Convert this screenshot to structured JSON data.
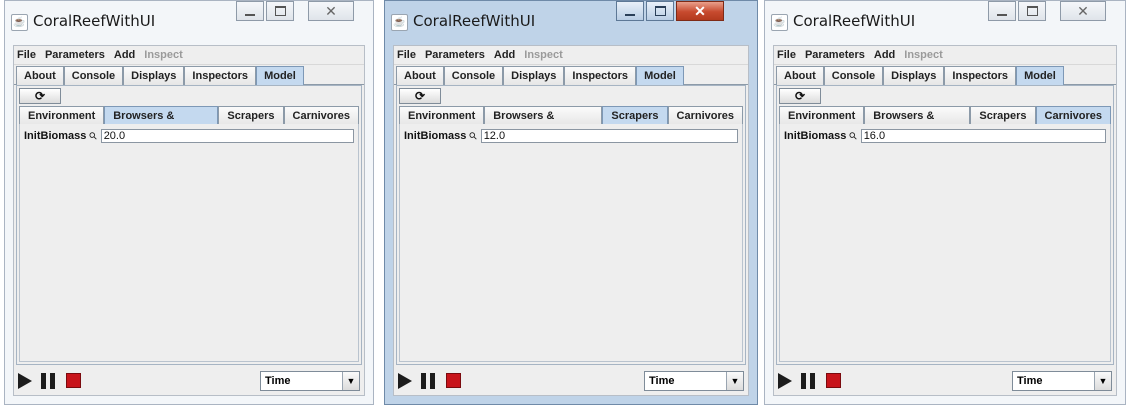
{
  "windows": [
    {
      "title": "CoralReefWithUI",
      "active": false,
      "menu": [
        "File",
        "Parameters",
        "Add",
        "Inspect"
      ],
      "main_tabs": [
        "About",
        "Console",
        "Displays",
        "Inspectors",
        "Model"
      ],
      "main_selected": "Model",
      "reload_icon": "refresh-icon",
      "sub_tabs": [
        "Environment",
        "Browsers & Grazers",
        "Scrapers",
        "Carnivores"
      ],
      "sub_selected": "Browsers & Grazers",
      "field_label": "InitBiomass",
      "field_value": "20.0",
      "time_label": "Time"
    },
    {
      "title": "CoralReefWithUI",
      "active": true,
      "menu": [
        "File",
        "Parameters",
        "Add",
        "Inspect"
      ],
      "main_tabs": [
        "About",
        "Console",
        "Displays",
        "Inspectors",
        "Model"
      ],
      "main_selected": "Model",
      "reload_icon": "refresh-icon",
      "sub_tabs": [
        "Environment",
        "Browsers & Grazers",
        "Scrapers",
        "Carnivores"
      ],
      "sub_selected": "Scrapers",
      "field_label": "InitBiomass",
      "field_value": "12.0",
      "time_label": "Time"
    },
    {
      "title": "CoralReefWithUI",
      "active": false,
      "menu": [
        "File",
        "Parameters",
        "Add",
        "Inspect"
      ],
      "main_tabs": [
        "About",
        "Console",
        "Displays",
        "Inspectors",
        "Model"
      ],
      "main_selected": "Model",
      "reload_icon": "refresh-icon",
      "sub_tabs": [
        "Environment",
        "Browsers & Grazers",
        "Scrapers",
        "Carnivores"
      ],
      "sub_selected": "Carnivores",
      "field_label": "InitBiomass",
      "field_value": "16.0",
      "time_label": "Time"
    }
  ]
}
